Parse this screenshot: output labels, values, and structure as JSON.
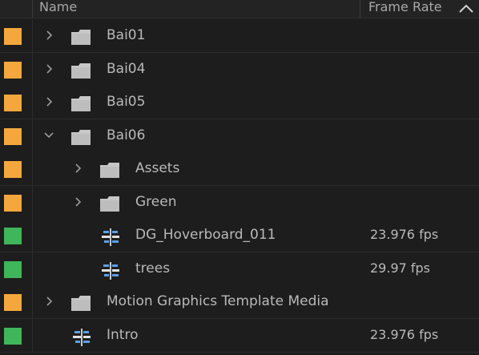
{
  "header": {
    "name_label": "Name",
    "frame_rate_label": "Frame Rate",
    "sort_icon": "chevron-up-icon"
  },
  "colors": {
    "folder_label": "#f4a73c",
    "sequence_label": "#3fb659",
    "background": "#1d1d1d"
  },
  "items": [
    {
      "name": "Bai01",
      "type": "folder",
      "expanded": false,
      "depth": 0,
      "frame_rate": ""
    },
    {
      "name": "Bai04",
      "type": "folder",
      "expanded": false,
      "depth": 0,
      "frame_rate": ""
    },
    {
      "name": "Bai05",
      "type": "folder",
      "expanded": false,
      "depth": 0,
      "frame_rate": ""
    },
    {
      "name": "Bai06",
      "type": "folder",
      "expanded": true,
      "depth": 0,
      "frame_rate": ""
    },
    {
      "name": "Assets",
      "type": "folder",
      "expanded": false,
      "depth": 1,
      "frame_rate": ""
    },
    {
      "name": "Green",
      "type": "folder",
      "expanded": false,
      "depth": 1,
      "frame_rate": ""
    },
    {
      "name": "DG_Hoverboard_011",
      "type": "sequence",
      "depth": 1,
      "frame_rate": "23.976 fps"
    },
    {
      "name": "trees",
      "type": "sequence",
      "depth": 1,
      "frame_rate": "29.97 fps"
    },
    {
      "name": "Motion Graphics Template Media",
      "type": "folder",
      "expanded": false,
      "depth": 0,
      "frame_rate": ""
    },
    {
      "name": "Intro",
      "type": "sequence",
      "depth": 0,
      "frame_rate": "23.976 fps"
    }
  ]
}
